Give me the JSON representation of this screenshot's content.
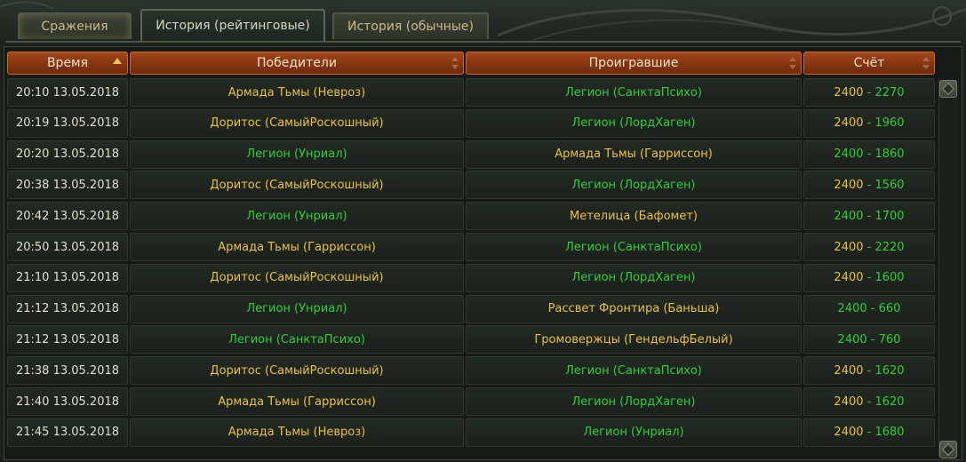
{
  "tabs": [
    {
      "label": "Сражения"
    },
    {
      "label": "История (рейтинговые)"
    },
    {
      "label": "История (обычные)"
    }
  ],
  "columns": {
    "time": "Время",
    "winners": "Победители",
    "losers": "Проигравшие",
    "score": "Счёт"
  },
  "colors": {
    "winner_yellow": "#e9c33b",
    "legion_green": "#2fcf3a",
    "header_orange": "#8a3812"
  },
  "rows": [
    {
      "time": "20:10 13.05.2018",
      "winner": "Армада Тьмы (Невроз)",
      "loser": "Легион (СанктаПсихо)",
      "score_w": "2400",
      "score_l": "2270"
    },
    {
      "time": "20:19 13.05.2018",
      "winner": "Доритос (СамыйРоскошный)",
      "loser": "Легион (ЛордХаген)",
      "score_w": "2400",
      "score_l": "1960"
    },
    {
      "time": "20:20 13.05.2018",
      "winner": "Легион (Унриал)",
      "loser": "Армада Тьмы (Гарриссон)",
      "score_w": "2400",
      "score_l": "1860"
    },
    {
      "time": "20:38 13.05.2018",
      "winner": "Доритос (СамыйРоскошный)",
      "loser": "Легион (ЛордХаген)",
      "score_w": "2400",
      "score_l": "1560"
    },
    {
      "time": "20:42 13.05.2018",
      "winner": "Легион (Унриал)",
      "loser": "Метелица (Бафомет)",
      "score_w": "2400",
      "score_l": "1700"
    },
    {
      "time": "20:50 13.05.2018",
      "winner": "Армада Тьмы (Гарриссон)",
      "loser": "Легион (СанктаПсихо)",
      "score_w": "2400",
      "score_l": "2220"
    },
    {
      "time": "21:10 13.05.2018",
      "winner": "Доритос (СамыйРоскошный)",
      "loser": "Легион (ЛордХаген)",
      "score_w": "2400",
      "score_l": "1600"
    },
    {
      "time": "21:12 13.05.2018",
      "winner": "Легион (Унриал)",
      "loser": "Рассвет Фронтира (Баньша)",
      "score_w": "2400",
      "score_l": "660"
    },
    {
      "time": "21:12 13.05.2018",
      "winner": "Легион (СанктаПсихо)",
      "loser": "Громовержцы (ГендельфБелый)",
      "score_w": "2400",
      "score_l": "760"
    },
    {
      "time": "21:38 13.05.2018",
      "winner": "Доритос (СамыйРоскошный)",
      "loser": "Легион (СанктаПсихо)",
      "score_w": "2400",
      "score_l": "1620"
    },
    {
      "time": "21:40 13.05.2018",
      "winner": "Армада Тьмы (Гарриссон)",
      "loser": "Легион (ЛордХаген)",
      "score_w": "2400",
      "score_l": "1620"
    },
    {
      "time": "21:45 13.05.2018",
      "winner": "Армада Тьмы (Невроз)",
      "loser": "Легион (Унриал)",
      "score_w": "2400",
      "score_l": "1680"
    }
  ]
}
